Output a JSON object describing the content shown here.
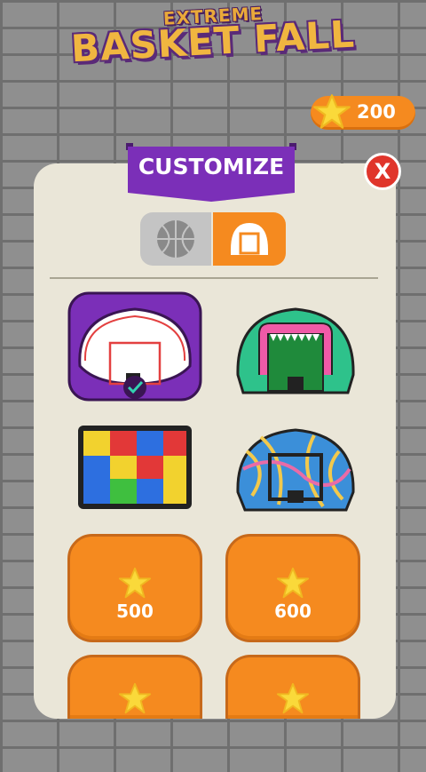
{
  "logo": {
    "line1": "EXTREME",
    "line2": "BASKET FALL"
  },
  "currency": {
    "amount": "200",
    "icon": "star-icon"
  },
  "panel": {
    "title": "CUSTOMIZE",
    "close_label": "X"
  },
  "tabs": [
    {
      "name": "balls",
      "icon": "basketball-icon",
      "selected": false
    },
    {
      "name": "backboards",
      "icon": "backboard-icon",
      "selected": true
    }
  ],
  "items": [
    {
      "name": "classic",
      "owned": true,
      "selected": true
    },
    {
      "name": "monster",
      "owned": true,
      "selected": false
    },
    {
      "name": "blocks",
      "owned": true,
      "selected": false
    },
    {
      "name": "swirl",
      "owned": true,
      "selected": false
    },
    {
      "name": "locked-1",
      "owned": false,
      "price": "500"
    },
    {
      "name": "locked-2",
      "owned": false,
      "price": "600"
    },
    {
      "name": "locked-3",
      "owned": false,
      "price": ""
    },
    {
      "name": "locked-4",
      "owned": false,
      "price": ""
    }
  ],
  "colors": {
    "accent_orange": "#f58a1f",
    "purple": "#7b2fb8",
    "panel_bg": "#eae6d8"
  }
}
